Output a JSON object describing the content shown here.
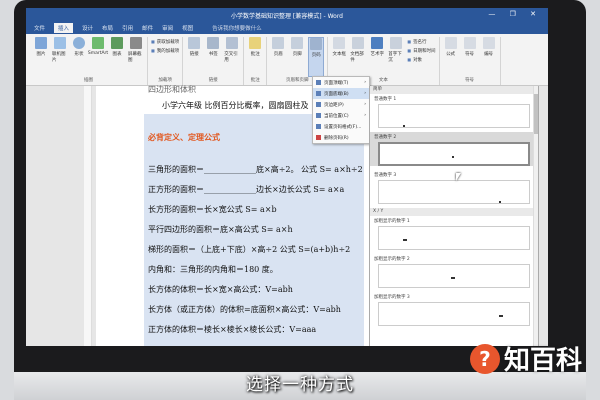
{
  "window": {
    "title": "小学数学基础知识整理 [兼容模式] - Word",
    "controls": "— ❐ ✕"
  },
  "tabs": [
    "插入",
    "设计",
    "布局",
    "引用",
    "邮件",
    "审阅",
    "视图"
  ],
  "tabs_prefix": "文件",
  "tell_me": "告诉我你想要做什么",
  "ribbon": {
    "groups": [
      {
        "label": "插图",
        "buttons": [
          "图片",
          "联机图片",
          "形状",
          "SmartArt",
          "图表",
          "屏幕截图"
        ]
      },
      {
        "label": "加载项",
        "buttons": [
          "获取加载项",
          "我的加载项"
        ]
      },
      {
        "label": "链接",
        "buttons": [
          "链接",
          "书签",
          "交叉引用"
        ]
      },
      {
        "label": "批注",
        "buttons": [
          "批注"
        ]
      },
      {
        "label": "页眉和页脚",
        "buttons": [
          "页眉",
          "页脚",
          "页码"
        ]
      },
      {
        "label": "文本",
        "buttons": [
          "文本框",
          "文档部件",
          "艺术字",
          "首字下沉"
        ]
      },
      {
        "label": "符号",
        "buttons": [
          "公式",
          "符号",
          "编号"
        ]
      }
    ],
    "text_side": [
      "签名行",
      "日期和时间",
      "对象"
    ]
  },
  "document": {
    "lines": [
      "四边形和体积",
      "小学六年级  比例百分比概率，圆扇圆柱及",
      "必背定义、定理公式",
      "三角形的面积＝_____________底×高÷2。 公式 S= a×h÷2",
      "正方形的面积＝_____________边长×边长公式 S= a×a",
      "长方形的面积＝长×宽公式 S= a×b",
      "平行四边形的面积＝底×高公式 S= a×h",
      "梯形的面积＝（上底+下底）×高÷2 公式 S=(a+b)h÷2",
      "内角和：三角形的内角和＝180 度。",
      "长方体的体积＝长×宽×高公式：V=abh",
      "长方体（或正方体）的体积=底面积×高公式：V=abh",
      "正方体的体积＝棱长×棱长×棱长公式：V=aaa"
    ]
  },
  "menu": {
    "items": [
      "页面顶端(T)",
      "页面底端(B)",
      "页边距(P)",
      "当前位置(C)",
      "设置页码格式(F)...",
      "删除页码(R)"
    ]
  },
  "gallery": {
    "section1": "简单",
    "items1": [
      "普通数字 1",
      "普通数字 2",
      "普通数字 3"
    ],
    "section2": "X / Y",
    "items2": [
      "加粗显示的数字 1",
      "加粗显示的数字 2",
      "加粗显示的数字 3"
    ]
  },
  "caption": "选择一种方式",
  "logo": {
    "mark": "?",
    "text": "知百科"
  }
}
